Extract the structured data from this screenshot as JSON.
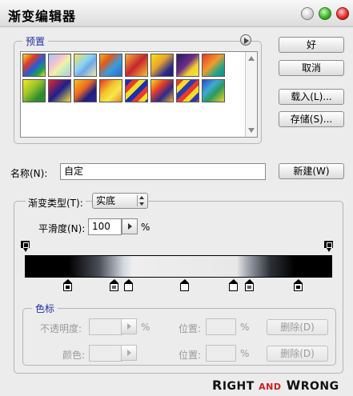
{
  "window": {
    "title": "渐变编辑器"
  },
  "presets": {
    "label": "预置",
    "swatches": [
      {
        "name": "swatch-1",
        "css": "linear-gradient(135deg,#f0e21a,#e23a2a 30%,#2a5ad6 55%,#1fa44b 80%,#f0e21a)"
      },
      {
        "name": "swatch-2",
        "css": "linear-gradient(135deg,#9ec9f0,#f6c1d6 35%,#f1f1a6 55%,#b6e6c6 80%,#e6b7e8)"
      },
      {
        "name": "swatch-3",
        "css": "linear-gradient(135deg,#f6e35a,#8ed5f0 40%,#6fa9e8 60%,#f5e9a8)"
      },
      {
        "name": "swatch-4",
        "css": "linear-gradient(135deg,#f0b020,#e05a1c 30%,#3a9be0 60%,#2e6ec0)"
      },
      {
        "name": "swatch-5",
        "css": "linear-gradient(135deg,#f3b33c,#c8242f 50%,#f4c431)"
      },
      {
        "name": "swatch-6",
        "css": "linear-gradient(135deg,#f6e116,#e8a62a 40%,#2a2a90 75%,#1a1e63)"
      },
      {
        "name": "swatch-7",
        "css": "linear-gradient(135deg,#2b1a66,#6c2b8a 45%,#f1d12a 70%,#f0e34a)"
      },
      {
        "name": "swatch-8",
        "css": "linear-gradient(135deg,#e9382a,#f09a2b 45%,#1fa58a 75%,#1c8a88)"
      },
      {
        "name": "swatch-9",
        "css": "linear-gradient(135deg,#f3e81f,#9cc42a 40%,#2e8c2e 75%)"
      },
      {
        "name": "swatch-10",
        "css": "linear-gradient(135deg,#e9262e,#1c1f8c 50%,#f1e13a)"
      },
      {
        "name": "swatch-11",
        "css": "linear-gradient(135deg,#f4c21e,#f06a1f 40%,#1d1f7d 70%,#2c2a98)"
      },
      {
        "name": "swatch-12",
        "css": "linear-gradient(135deg,#e7332a,#f5c52a 40%,#f7e74a 65%,#e6882a)"
      },
      {
        "name": "swatch-13",
        "css": "repeating-linear-gradient(135deg,#1b2fb0 0,#1b2fb0 6px,#e83a2a 6px,#e83a2a 12px,#f1e02a 12px,#f1e02a 18px)"
      },
      {
        "name": "swatch-14",
        "css": "linear-gradient(135deg,#f7e21a,#e83b2a 35%,#2a2a8c 65%,#f1b12a)"
      },
      {
        "name": "swatch-15",
        "css": "repeating-linear-gradient(135deg,#e83a2a 0,#e83a2a 6px,#f6dd2a 6px,#f6dd2a 12px,#2a3bb0 12px,#2a3bb0 18px)"
      },
      {
        "name": "swatch-16",
        "css": "linear-gradient(135deg,#2f45c8,#3fa9d8 35%,#2b9a5a 60%,#f1d12a)"
      }
    ]
  },
  "buttons": {
    "ok": "好",
    "cancel": "取消",
    "load": "载入(L)...",
    "save": "存储(S)...",
    "new": "新建(W)"
  },
  "name_field": {
    "label": "名称(N):",
    "value": "自定"
  },
  "gradient_type": {
    "label": "渐变类型(T):",
    "value": "实底"
  },
  "smoothness": {
    "label": "平滑度(N):",
    "value": "100",
    "unit": "%"
  },
  "stops_group": {
    "label": "色标",
    "opacity_label": "不透明度:",
    "opacity_unit": "%",
    "location_label_1": "位置:",
    "location_unit_1": "%",
    "delete_label_1": "删除(D)",
    "color_label": "颜色:",
    "location_label_2": "位置:",
    "location_unit_2": "%",
    "delete_label_2": "删除(D)"
  },
  "watermark": {
    "part1_cap": "R",
    "part1": "IGHT ",
    "and": "AND",
    "part2_cap": " W",
    "part2": "RONG"
  }
}
